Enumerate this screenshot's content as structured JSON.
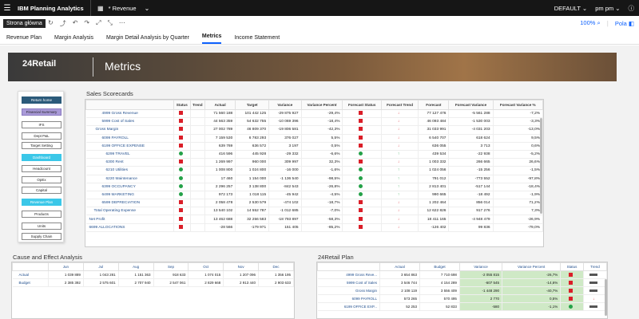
{
  "topbar": {
    "app_name": "IBM Planning Analytics",
    "doc_title": "* Revenue",
    "env": "DEFAULT",
    "user": "pm pm"
  },
  "tooltip": "Strona główna",
  "toolbar": {
    "zoom": "100%",
    "fields": "Pola"
  },
  "tabs": [
    {
      "label": "Revenue Plan"
    },
    {
      "label": "Margin Analysis"
    },
    {
      "label": "Margin Detail Analysis by Quarter"
    },
    {
      "label": "Metrics"
    },
    {
      "label": "Income Statement"
    }
  ],
  "banner": {
    "logo": "24Retail",
    "title": "Metrics"
  },
  "nav": [
    "Return home",
    "Financial Summary",
    "IFS",
    "Dept P&L",
    "Target Setting",
    "Dashboard",
    "Headcount",
    "OpEx",
    "Capital",
    "Revenue Plan",
    "Products",
    "Units",
    "Supply Chain"
  ],
  "scorecards": {
    "title": "Sales Scorecards",
    "headers": [
      "Status",
      "Trend",
      "Actual",
      "Target",
      "Variance",
      "Variance Percent",
      "Forecast Status",
      "Forecast Trend",
      "Forecast",
      "Forecast Variance",
      "Forecast Variance %"
    ],
    "rows": [
      {
        "label": "4999 Gross Revenue",
        "status": "sq",
        "actual": "71 560 188",
        "target": "101 442 125",
        "variance": "-29 875 927",
        "vp": "-29,4%",
        "fs": "sq",
        "ft": "dn",
        "forecast": "77 127 476",
        "fv": "-5 561 288",
        "fvp": "-7,2%"
      },
      {
        "label": "5999 Cost of Sales",
        "status": "sq",
        "actual": "44 563 359",
        "target": "54 632 755",
        "variance": "-10 069 396",
        "vp": "-18,4%",
        "fs": "sq",
        "ft": "dn",
        "forecast": "46 093 484",
        "fv": "-1 530 003",
        "fvp": "-3,3%"
      },
      {
        "label": "Gross Margin",
        "status": "sq",
        "actual": "27 002 789",
        "target": "46 809 370",
        "variance": "-19 806 581",
        "vp": "-42,3%",
        "fs": "sq",
        "ft": "dn",
        "forecast": "31 033 991",
        "fv": "-4 031 203",
        "fvp": "-13,0%"
      },
      {
        "label": "6099 PAYROLL",
        "status": "sq",
        "actual": "7 159 530",
        "target": "6 783 293",
        "variance": "376 027",
        "vp": "5,5%",
        "fs": "sq",
        "ft": "dn",
        "forecast": "6 540 707",
        "fv": "618 624",
        "fvp": "9,5%"
      },
      {
        "label": "6199 OFFICE EXPENSE",
        "status": "sq",
        "actual": "639 769",
        "target": "636 572",
        "variance": "3 197",
        "vp": "0,5%",
        "fs": "sq",
        "ft": "dn",
        "forecast": "636 055",
        "fv": "3 713",
        "fvp": "0,6%"
      },
      {
        "label": "6299 TRAVEL",
        "status": "dot",
        "actual": "416 596",
        "target": "445 928",
        "variance": "-29 332",
        "vp": "-6,6%",
        "fs": "dot",
        "ft": "up",
        "forecast": "439 534",
        "fv": "-22 938",
        "fvp": "-5,2%"
      },
      {
        "label": "6300 Rent",
        "status": "sq",
        "actual": "1 269 997",
        "target": "960 000",
        "variance": "309 997",
        "vp": "32,3%",
        "fs": "sq",
        "ft": "dn",
        "forecast": "1 003 332",
        "fv": "266 665",
        "fvp": "26,6%"
      },
      {
        "label": "6210 Utilities",
        "status": "dot",
        "actual": "1 008 800",
        "target": "1 024 800",
        "variance": "-16 000",
        "vp": "-1,6%",
        "fs": "dot",
        "ft": "up",
        "forecast": "1 024 056",
        "fv": "-15 256",
        "fvp": "-1,5%"
      },
      {
        "label": "6220 Maintenance",
        "status": "dot",
        "actual": "17 460",
        "target": "1 154 000",
        "variance": "-1 136 540",
        "vp": "-98,5%",
        "fs": "dot",
        "ft": "up",
        "forecast": "791 012",
        "fv": "-773 552",
        "fvp": "-97,8%"
      },
      {
        "label": "6399 OCCUPANCY",
        "status": "dot",
        "actual": "2 296 257",
        "target": "3 138 800",
        "variance": "-842 543",
        "vp": "-26,8%",
        "fs": "dot",
        "ft": "up",
        "forecast": "2 813 401",
        "fv": "-517 144",
        "fvp": "-18,4%"
      },
      {
        "label": "6499 MARKETING",
        "status": "dot",
        "actual": "972 173",
        "target": "1 018 115",
        "variance": "-45 942",
        "vp": "-4,5%",
        "fs": "dot",
        "ft": "up",
        "forecast": "990 665",
        "fv": "-18 492",
        "fvp": "-1,9%"
      },
      {
        "label": "6599 DEPRECIATION",
        "status": "sq",
        "actual": "2 058 478",
        "target": "2 530 579",
        "variance": "-474 102",
        "vp": "-18,7%",
        "fs": "sq",
        "ft": "dn",
        "forecast": "1 202 464",
        "fv": "856 014",
        "fvp": "71,2%"
      },
      {
        "label": "Total Operating Expense",
        "status": "sq",
        "actual": "13 540 102",
        "target": "14 552 787",
        "variance": "-1 012 685",
        "vp": "-7,0%",
        "fs": "sq",
        "ft": "dn",
        "forecast": "12 622 826",
        "fv": "917 276",
        "fvp": "7,3%"
      },
      {
        "label": "Net Profit",
        "status": "sq",
        "actual": "13 462 688",
        "target": "32 256 583",
        "variance": "-18 793 897",
        "vp": "-58,3%",
        "fs": "sq",
        "ft": "dn",
        "forecast": "18 411 165",
        "fv": "-4 948 479",
        "fvp": "-26,9%"
      },
      {
        "label": "6699 ALLOCATIONS",
        "status": "sq",
        "actual": "-28 566",
        "target": "-179 971",
        "variance": "151 405",
        "vp": "-85,2%",
        "fs": "sq",
        "ft": "dn",
        "forecast": "-126 402",
        "fv": "99 836",
        "fvp": "-79,0%"
      }
    ]
  },
  "cause_effect": {
    "title": "Cause and Effect Analysis",
    "months": [
      "Jun",
      "Jul",
      "Aug",
      "Sep",
      "Oct",
      "Nov",
      "Dec"
    ],
    "rows": [
      {
        "label": "Actual",
        "values": [
          "1 039 889",
          "1 043 281",
          "1 151 363",
          "918 633",
          "1 074 015",
          "1 207 096",
          "1 356 195"
        ]
      },
      {
        "label": "Budget",
        "values": [
          "2 385 392",
          "2 575 601",
          "2 707 940",
          "2 547 061",
          "2 829 668",
          "2 913 440",
          "2 903 633"
        ]
      }
    ]
  },
  "plan": {
    "title": "24Retail Plan",
    "headers": [
      "Actual",
      "Budget",
      "Variance",
      "Variance Percent",
      "Status",
      "Trend"
    ],
    "rows": [
      {
        "label": "4999 Gross Reve...",
        "actual": "3 654 863",
        "budget": "7 710 698",
        "variance": "-2 055 815",
        "vp": "-26,7%",
        "status": "sq",
        "trend": "dash"
      },
      {
        "label": "5999 Cost of Sales",
        "actual": "3 546 744",
        "budget": "4 154 289",
        "variance": "-607 545",
        "vp": "-14,6%",
        "status": "sq",
        "trend": "dash"
      },
      {
        "label": "Gross Margin",
        "actual": "2 108 119",
        "budget": "3 556 409",
        "variance": "-1 448 290",
        "vp": "-40,7%",
        "status": "sq",
        "trend": "dash"
      },
      {
        "label": "6099 PAYROLL",
        "actual": "573 265",
        "budget": "570 495",
        "variance": "2 770",
        "vp": "0,5%",
        "status": "sq",
        "trend": "dn"
      },
      {
        "label": "6199 OFFICE EXP...",
        "actual": "52 253",
        "budget": "52 833",
        "variance": "-580",
        "vp": "-1,1%",
        "status": "dot",
        "trend": "dash"
      }
    ]
  }
}
